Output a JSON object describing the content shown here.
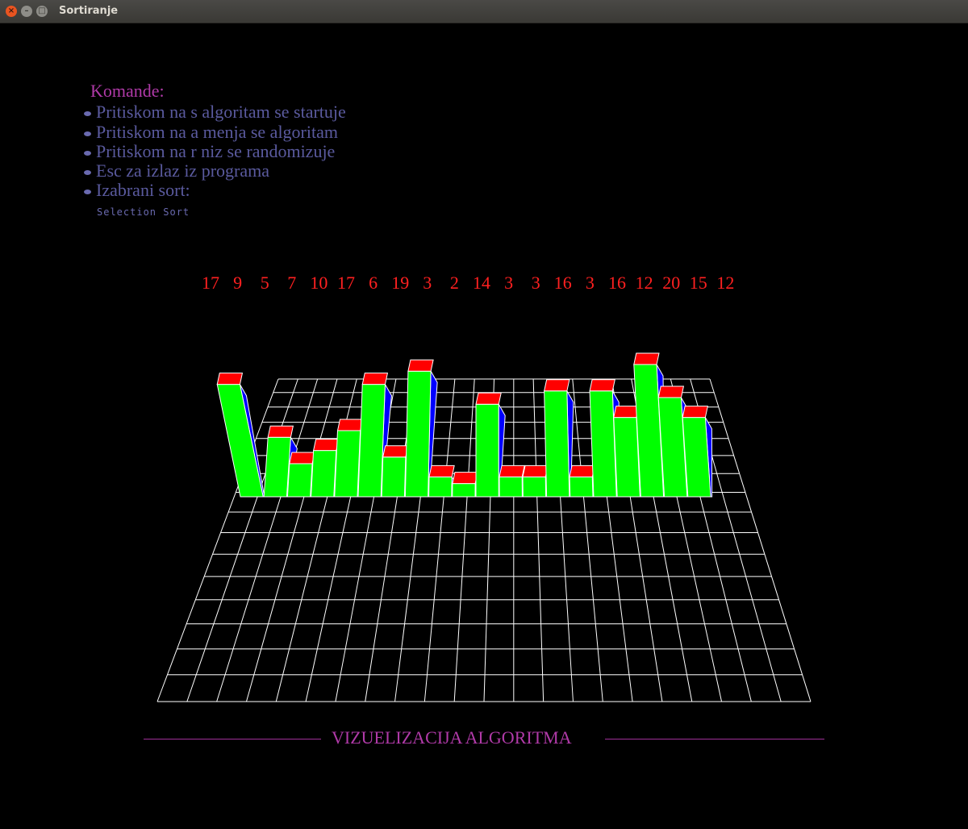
{
  "window": {
    "title": "Sortiranje",
    "buttons": {
      "close": "×",
      "minimize": "–",
      "maximize": "□"
    }
  },
  "commands": {
    "heading": "Komande:",
    "items": [
      "Pritiskom na s algoritam se startuje",
      "Pritiskom na a menja se algoritam",
      "Pritiskom na r niz se randomizuje",
      "Esc za izlaz iz programa",
      "Izabrani sort:"
    ],
    "selected_sort": "Selection Sort"
  },
  "colors": {
    "bar_front": "#00ff00",
    "bar_top": "#ff0000",
    "bar_side": "#0000ff",
    "grid": "#ffffff",
    "heading": "#b03aa8",
    "command_text": "#5a5a9e",
    "values": "#ff2020"
  },
  "chart_data": {
    "type": "bar",
    "values": [
      17,
      9,
      5,
      7,
      10,
      17,
      6,
      19,
      3,
      2,
      14,
      3,
      3,
      16,
      3,
      16,
      12,
      20,
      15,
      12
    ]
  },
  "footer": {
    "title": "VIZUELIZACIJA ALGORITMA"
  }
}
